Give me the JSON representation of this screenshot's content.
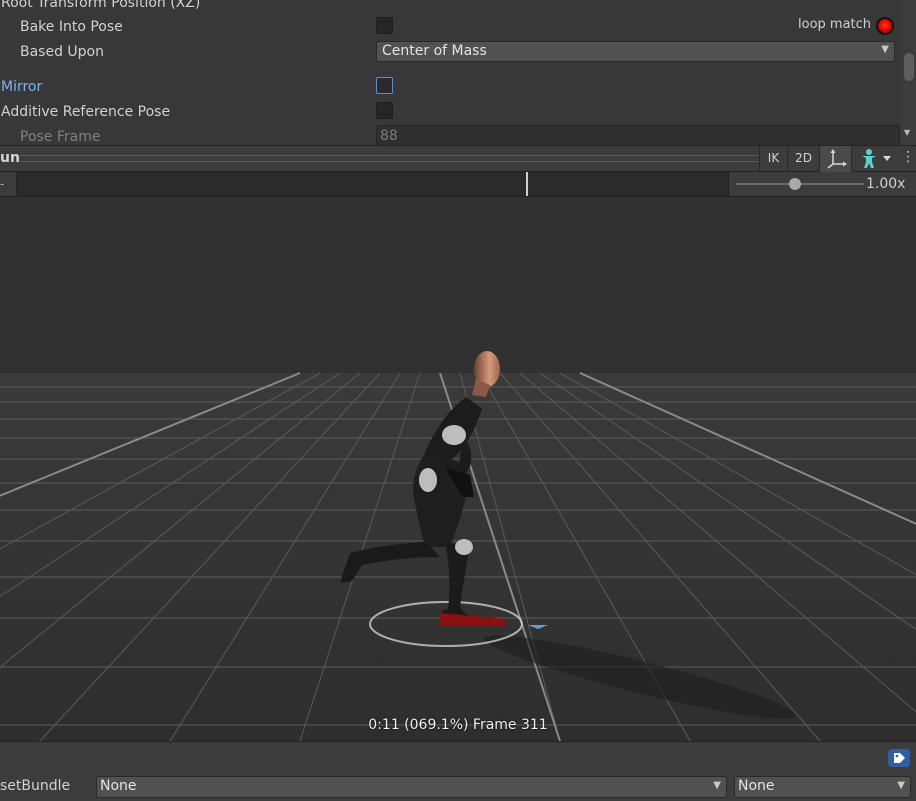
{
  "inspector": {
    "header_clipped": "Root Transform Position (XZ)",
    "bake_into_pose": "Bake Into Pose",
    "loop_match": "loop match",
    "based_upon": "Based Upon",
    "based_upon_value": "Center of Mass",
    "mirror": "Mirror",
    "additive_reference_pose": "Additive Reference Pose",
    "pose_frame": "Pose Frame",
    "pose_frame_value": "88",
    "loop_match_color": "#e00000"
  },
  "preview_toolbar": {
    "title_clipped": "un",
    "ik": "IK",
    "two_d": "2D",
    "pivot_icon": "pivot-axes-icon",
    "avatar_icon": "humanoid-avatar-icon",
    "more": "⋮"
  },
  "timeline": {
    "left_marker": "-",
    "speed": "1.00x",
    "speed_slider_fraction": 0.47,
    "playhead_fraction": 0.69
  },
  "viewport": {
    "frame_info": "0:11 (069.1%) Frame 311"
  },
  "asset_bar": {
    "label_clipped": "setBundle",
    "bundle_value": "None",
    "variant_value": "None",
    "tag_icon": "label-tag-icon"
  }
}
